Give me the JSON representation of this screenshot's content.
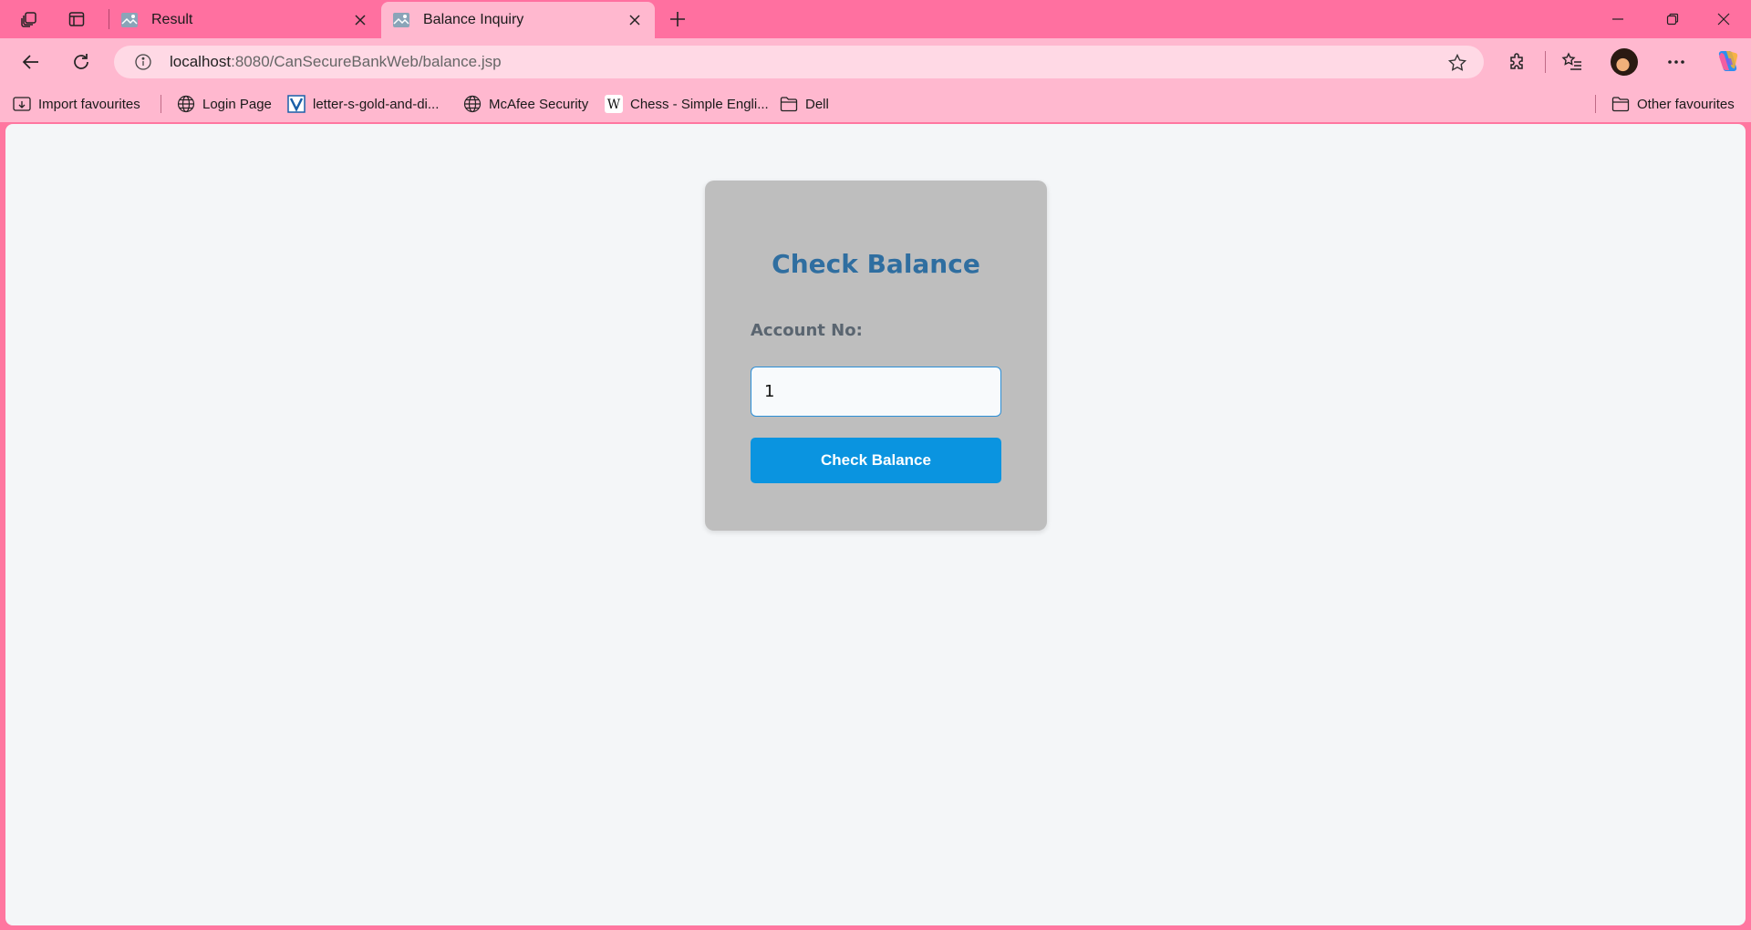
{
  "browser": {
    "tabs": [
      {
        "title": "Result",
        "active": false
      },
      {
        "title": "Balance Inquiry",
        "active": true
      }
    ],
    "address": {
      "host": "localhost",
      "path": ":8080/CanSecureBankWeb/balance.jsp"
    },
    "favorites": [
      {
        "label": "Import favourites",
        "icon": "import-icon"
      },
      {
        "label": "Login Page",
        "icon": "globe-icon"
      },
      {
        "label": "letter-s-gold-and-di...",
        "icon": "letter-v-favicon"
      },
      {
        "label": "McAfee Security",
        "icon": "globe-icon"
      },
      {
        "label": "Chess - Simple Engli...",
        "icon": "wikipedia-icon"
      },
      {
        "label": "Dell",
        "icon": "folder-icon"
      }
    ],
    "other_favorites": "Other favourites",
    "theme_color": "#ff70a0"
  },
  "page": {
    "title": "Check Balance",
    "account_label": "Account No:",
    "account_value": "1",
    "submit_label": "Check Balance",
    "accent_color": "#0a94e0",
    "title_color": "#2f6ea0"
  }
}
